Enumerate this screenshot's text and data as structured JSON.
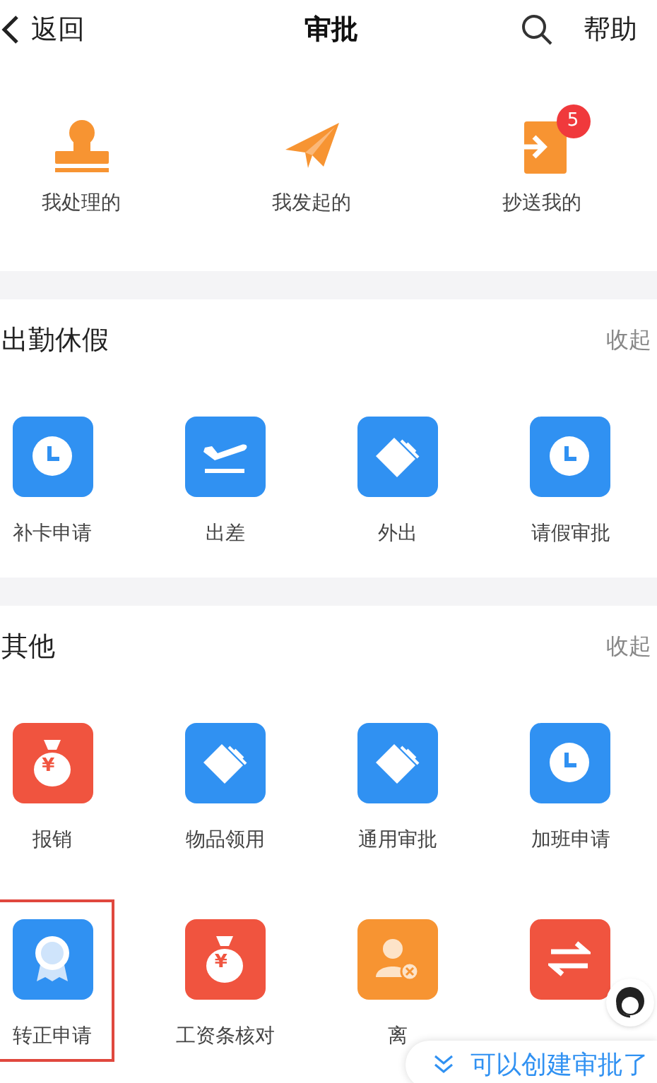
{
  "nav": {
    "back": "返回",
    "title": "审批",
    "help": "帮助"
  },
  "quick": [
    {
      "kind": "stamp",
      "label": "我处理的"
    },
    {
      "kind": "plane",
      "label": "我发起的"
    },
    {
      "kind": "inbox",
      "label": "抄送我的",
      "badge": "5"
    }
  ],
  "sections": [
    {
      "title": "出勤休假",
      "action": "收起",
      "items": [
        {
          "kind": "clock",
          "color": "#3091f2",
          "label": "补卡申请",
          "selected": false
        },
        {
          "kind": "takeoff",
          "color": "#3091f2",
          "label": "出差",
          "selected": false
        },
        {
          "kind": "tag",
          "color": "#3091f2",
          "label": "外出",
          "selected": false
        },
        {
          "kind": "clock",
          "color": "#3091f2",
          "label": "请假审批",
          "selected": false
        }
      ]
    },
    {
      "title": "其他",
      "action": "收起",
      "items": [
        {
          "kind": "moneybag",
          "color": "#f0543f",
          "symbol": "¥",
          "label": "报销",
          "selected": false
        },
        {
          "kind": "tag",
          "color": "#3091f2",
          "label": "物品领用",
          "selected": false
        },
        {
          "kind": "tag",
          "color": "#3091f2",
          "label": "通用审批",
          "selected": false
        },
        {
          "kind": "clock",
          "color": "#3091f2",
          "label": "加班申请",
          "selected": false
        },
        {
          "kind": "medal",
          "color": "#3091f2",
          "label": "转正申请",
          "selected": true
        },
        {
          "kind": "moneybag",
          "color": "#f0543f",
          "symbol": "¥",
          "label": "工资条核对",
          "selected": false
        },
        {
          "kind": "person-remove",
          "color": "#f79432",
          "label": "离",
          "selected": false
        },
        {
          "kind": "swap",
          "color": "#f0543f",
          "selected": false
        }
      ]
    }
  ],
  "floating": {
    "text": "可以创建审批了"
  }
}
